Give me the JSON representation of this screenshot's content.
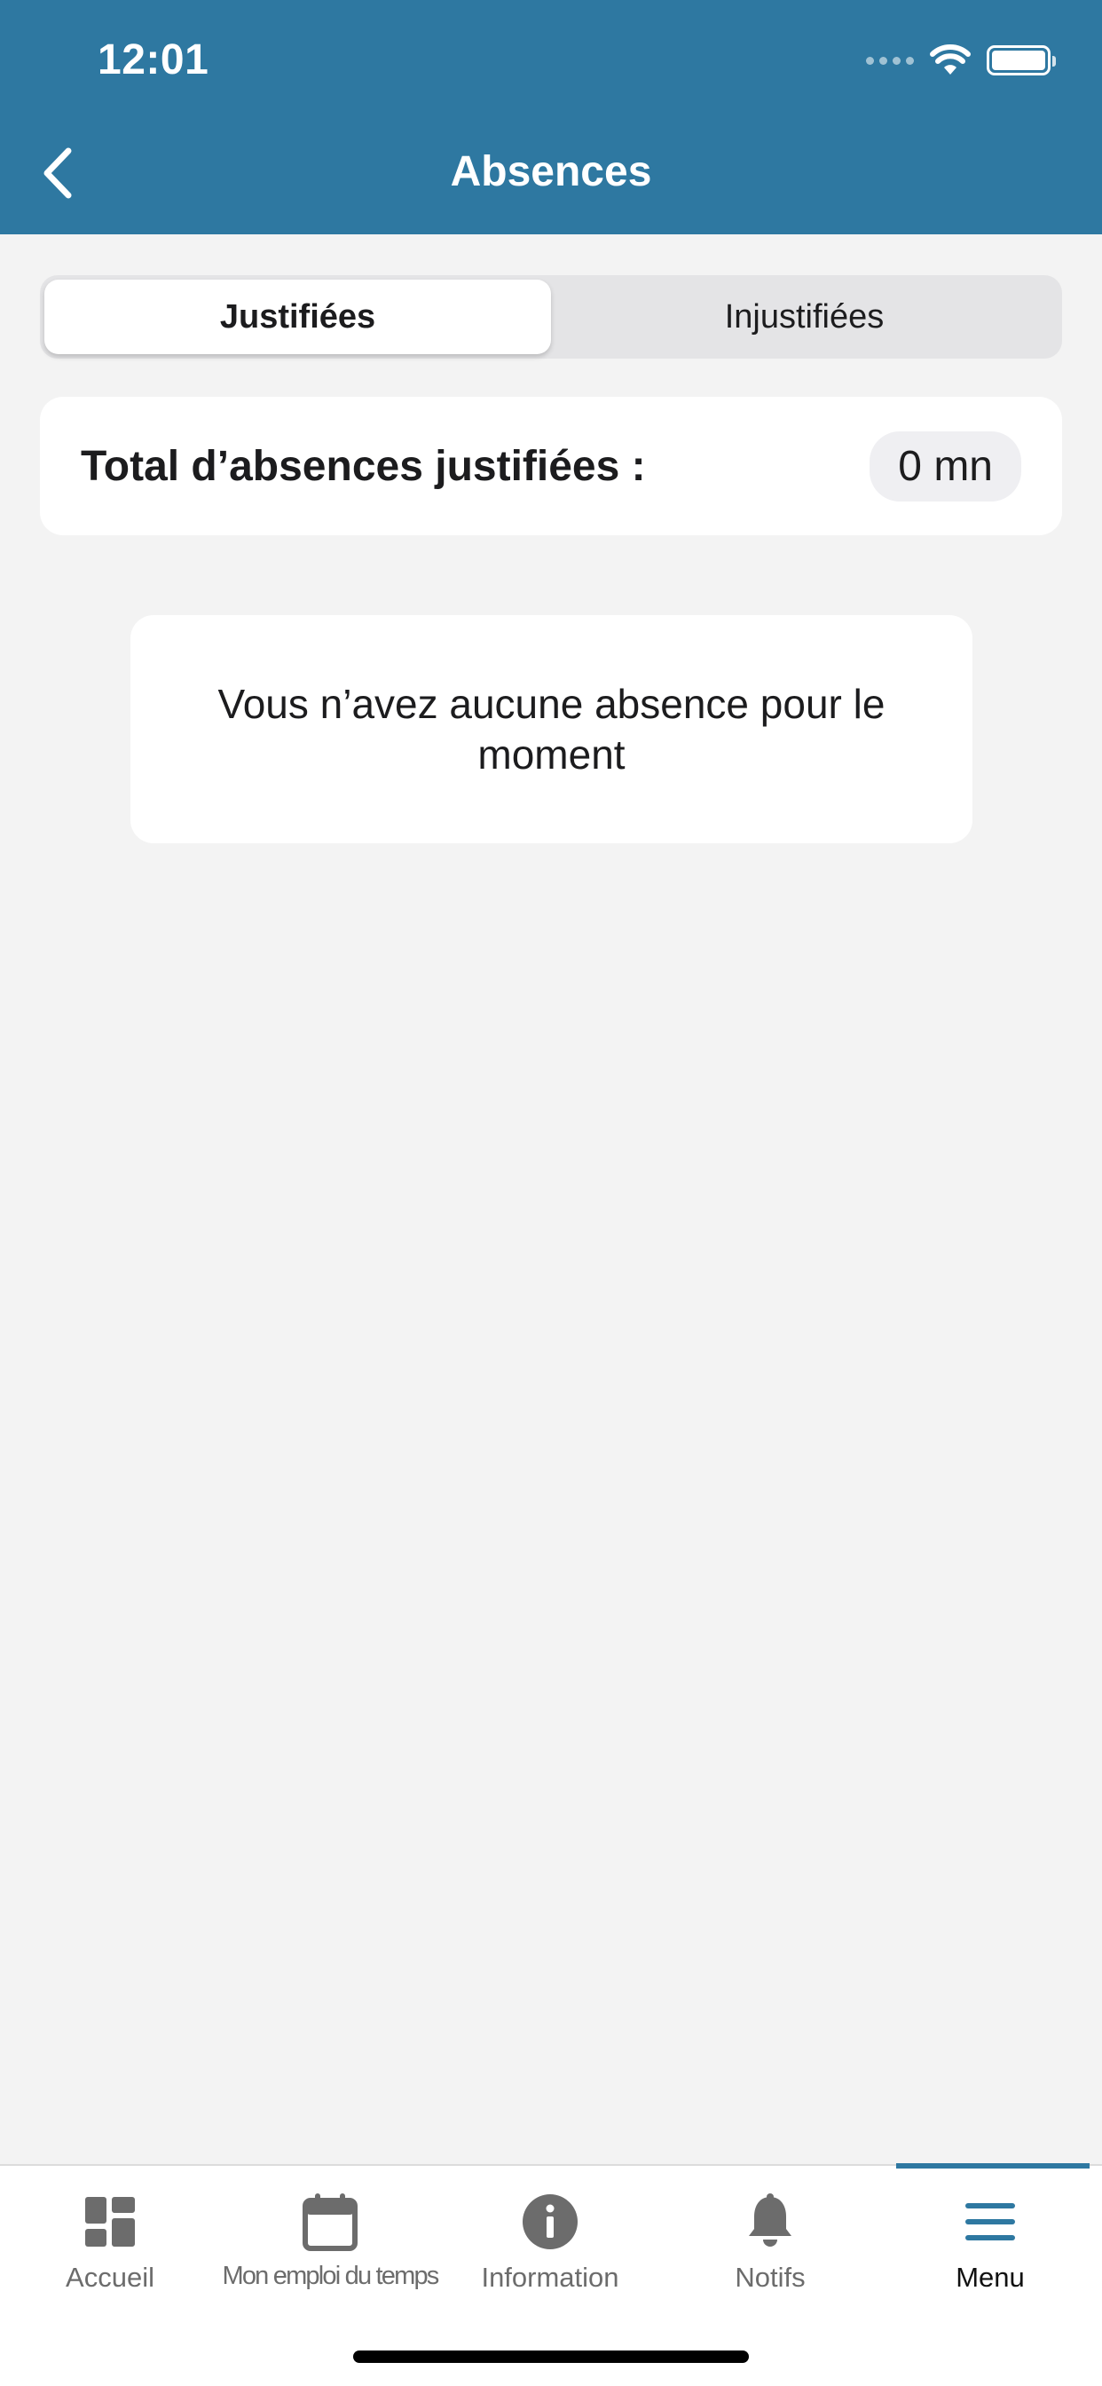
{
  "status_bar": {
    "time": "12:01"
  },
  "header": {
    "title": "Absences"
  },
  "segments": [
    {
      "label": "Justifiées",
      "active": true
    },
    {
      "label": "Injustifiées",
      "active": false
    }
  ],
  "total": {
    "label": "Total d’absences justifiées :",
    "value": "0 mn"
  },
  "empty_state": {
    "message": "Vous n’avez aucune absence pour le moment"
  },
  "tabbar": {
    "items": [
      {
        "label": "Accueil",
        "icon": "dashboard-icon"
      },
      {
        "label": "Mon emploi du temps",
        "icon": "calendar-icon"
      },
      {
        "label": "Information",
        "icon": "info-icon"
      },
      {
        "label": "Notifs",
        "icon": "bell-icon"
      },
      {
        "label": "Menu",
        "icon": "menu-icon",
        "active": true
      }
    ]
  },
  "colors": {
    "header": "#2e78a1",
    "accent": "#2e78a1",
    "background": "#f3f3f3",
    "icon_inactive": "#6c6c6c"
  }
}
